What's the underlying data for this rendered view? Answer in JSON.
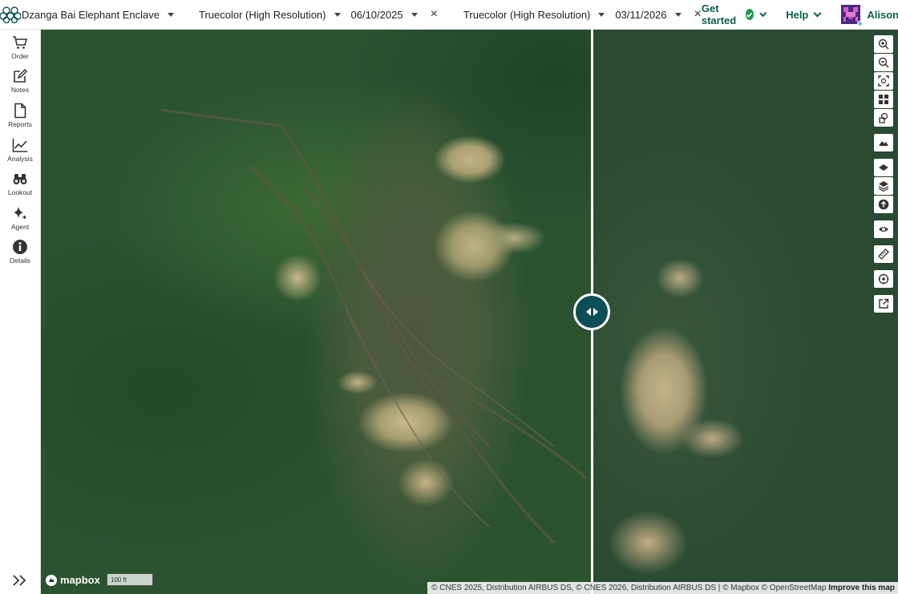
{
  "header": {
    "location": "Dzanga Bai Elephant Enclave",
    "left_layer": "Truecolor (High Resolution)",
    "left_date": "06/10/2025",
    "right_layer": "Truecolor (High Resolution)",
    "right_date": "03/11/2026",
    "close_symbol": "×",
    "get_started": "Get started",
    "help": "Help",
    "user": "Alison"
  },
  "sidebar": {
    "items": [
      {
        "label": "Order",
        "icon": "cart-icon"
      },
      {
        "label": "Notes",
        "icon": "edit-icon"
      },
      {
        "label": "Reports",
        "icon": "document-icon"
      },
      {
        "label": "Analysis",
        "icon": "line-chart-icon"
      },
      {
        "label": "Lookout",
        "icon": "binoculars-icon"
      },
      {
        "label": "Agent",
        "icon": "sparkle-icon"
      },
      {
        "label": "Details",
        "icon": "info-icon"
      }
    ],
    "expand_icon": "double-chevron-right-icon"
  },
  "map": {
    "scale_label": "100 ft",
    "logo_text": "mapbox",
    "attribution": "© CNES 2025, Distribution AIRBUS DS, © CNES 2026, Distribution AIRBUS DS | © Mapbox © OpenStreetMap",
    "improve_link": "Improve this map"
  },
  "tools": [
    "zoom-in-icon",
    "zoom-out-icon",
    "fit-bounds-icon",
    "grid-icon",
    "shapes-icon",
    "terrain-icon",
    "layer-icon",
    "layers-icon",
    "upload-icon",
    "eye-icon",
    "ruler-icon",
    "locate-icon",
    "external-link-icon"
  ],
  "colors": {
    "accent": "#0d5e4e",
    "handle": "#0e4f57",
    "success": "#1e9a4f"
  }
}
